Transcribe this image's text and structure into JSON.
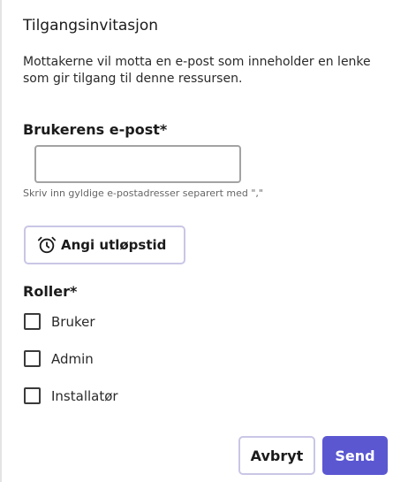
{
  "dialog": {
    "title": "Tilgangsinvitasjon",
    "description": "Mottakerne vil motta en e-post som inneholder en lenke som gir tilgang til denne ressursen."
  },
  "email": {
    "label": "Brukerens e-post*",
    "value": "",
    "placeholder": "",
    "hint": "Skriv inn gyldige e-postadresser separert med \",\""
  },
  "expiry": {
    "button_label": "Angi utløpstid",
    "icon": "alarm-clock-icon"
  },
  "roles": {
    "label": "Roller*",
    "items": [
      {
        "label": "Bruker",
        "checked": false
      },
      {
        "label": "Admin",
        "checked": false
      },
      {
        "label": "Installatør",
        "checked": false
      }
    ]
  },
  "actions": {
    "cancel_label": "Avbryt",
    "send_label": "Send"
  },
  "colors": {
    "primary": "#5b57d1",
    "secondary_border": "#c9c6e6"
  }
}
